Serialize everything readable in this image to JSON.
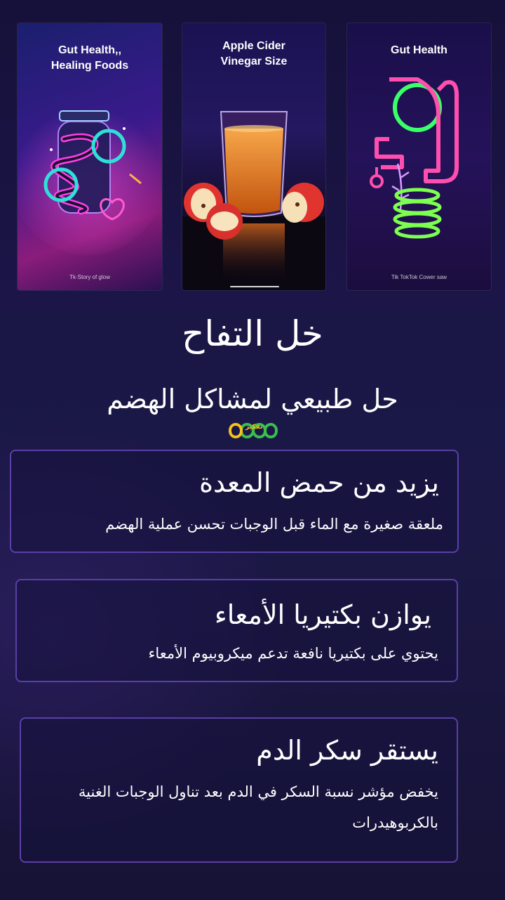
{
  "cards": [
    {
      "title_line1": "Gut Health,,",
      "title_line2": "Healing Foods",
      "footer": "Tk·Story of glow"
    },
    {
      "title_line1": "Apple Cider",
      "title_line2": "Vinegar Size",
      "footer": ""
    },
    {
      "title_line1": "Gut Health",
      "title_line2": "",
      "footer": "Tik TokTok Cower saw"
    }
  ],
  "main_title": "خل التفاح",
  "subtitle": "حل طبيعي لمشاكل الهضم",
  "logo": {
    "text": "تفكير",
    "colors": [
      "#f5c21a",
      "#3bbf4c"
    ]
  },
  "features": [
    {
      "title": "يزيد من حمض المعدة",
      "description": "ملعقة صغيرة مع الماء قبل الوجبات تحسن عملية الهضم"
    },
    {
      "title": "يوازن بكتيريا الأمعاء",
      "description": "يحتوي على بكتيريا نافعة تدعم ميكروبيوم الأمعاء"
    },
    {
      "title": "يستقر سكر الدم",
      "description": "يخفض مؤشر نسبة السكر في الدم بعد تناول الوجبات الغنية بالكربوهيدرات"
    }
  ],
  "colors": {
    "background": "#1a1747",
    "border": "#5a3fa6",
    "text": "#ffffff"
  }
}
